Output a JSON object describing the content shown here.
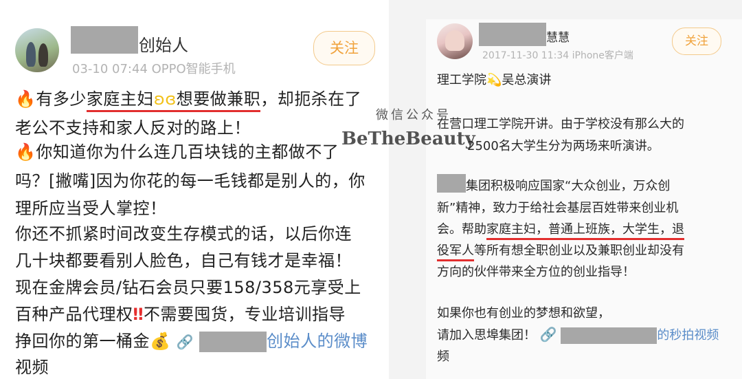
{
  "left_post": {
    "author_suffix": "创始人",
    "meta": "03-10 07:44  OPPO智能手机",
    "follow_label": "关注",
    "lines": [
      {
        "a": "有多少",
        "b": "家庭主妇",
        "c": "想要做兼职",
        "d": "，却扼杀在了"
      },
      "老公不支持和家人反对的路上！",
      "你知道你为什么连几百块钱的主都做不了",
      "吗？[撇嘴]因为你花的每一毛钱都是别人的，你",
      "理所应当受人掌控！",
      "你还不抓紧时间改变生存模式的话，以后你连",
      "几十块都要看别人脸色，自己有钱才是幸福！",
      "现在金牌会员/钻石会员只要158/358元享受上",
      {
        "a": "百种产品代理权",
        "b": "不需要囤货，专业培训指导"
      },
      {
        "a": "挣回你的第一桶金",
        "b": "创始人的微博"
      },
      "视频"
    ]
  },
  "right_post": {
    "author_suffix": "慧慧",
    "meta": "2017-11-30 11:34  iPhone客户端",
    "follow_label": "关注",
    "headline": {
      "a": "理工学院",
      "b": "吴总演讲"
    },
    "lines": [
      "在营口理工学院开讲。由于学校没有那么大的",
      "2500名大学生分为两场来听演讲。",
      "集团积极响应国家“大众创业，万众创",
      "新”精神，致力于给社会基层百姓带来创业机",
      {
        "a": "会。帮助",
        "b": "家庭主妇，普通上班族，大学生，退"
      },
      {
        "a": "役军人",
        "b": "等所有想全职创业以及兼职创业却没有"
      },
      "方向的伙伴带来全方位的创业指导！",
      "如果你也有创业的梦想和欲望，",
      {
        "a": "请加入思埠集团！",
        "b": "的秒拍视频"
      },
      "频"
    ]
  },
  "watermark": {
    "title": "微信公众号",
    "brand": "BeTheBeauty"
  },
  "colors": {
    "underline": "#e22e2e",
    "link": "#5b8dc9",
    "follow": "#f0a23b"
  },
  "icons": [
    "fire-icon",
    "butterfly-icon",
    "double-exclamation-icon",
    "money-bag-icon",
    "link-icon",
    "sparkle-icon"
  ]
}
